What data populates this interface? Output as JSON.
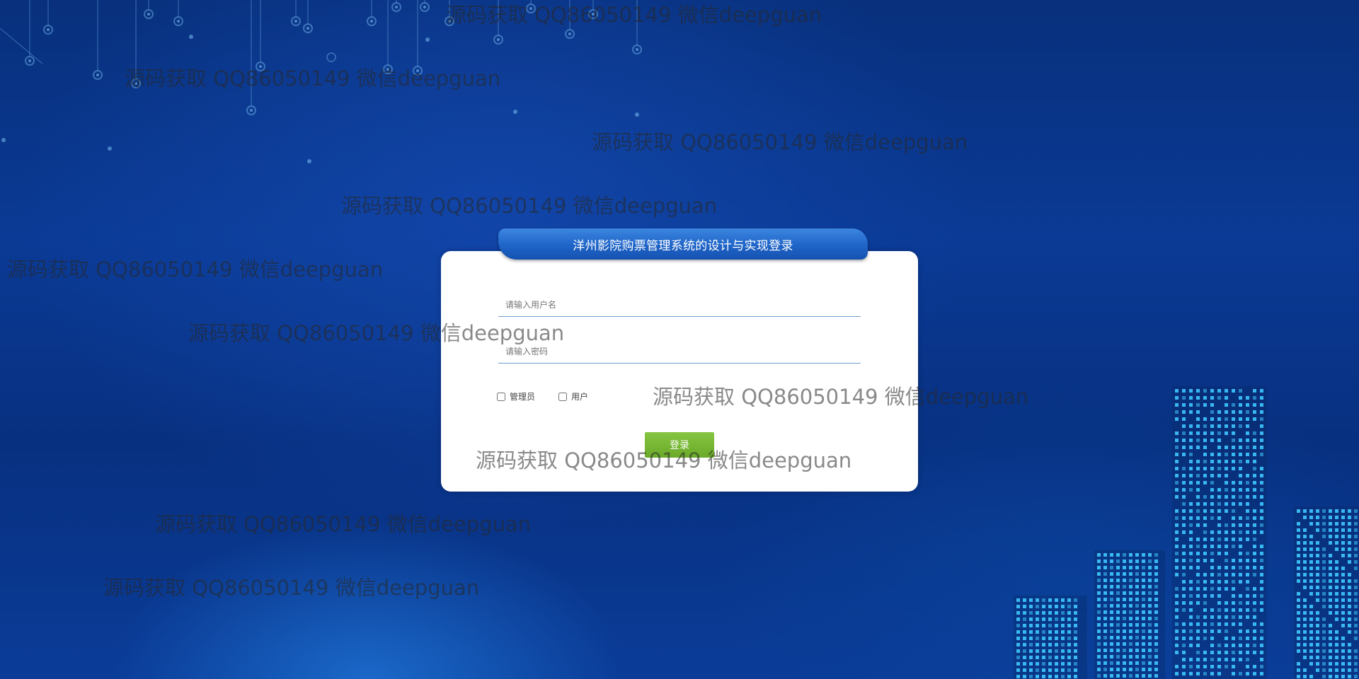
{
  "login": {
    "title": "洋州影院购票管理系统的设计与实现登录",
    "username_placeholder": "请输入用户名",
    "password_placeholder": "请输入密码",
    "roles": [
      {
        "label": "管理员",
        "checked": false
      },
      {
        "label": "用户",
        "checked": false
      }
    ],
    "submit_label": "登录"
  },
  "watermark": {
    "text": "源码获取 QQ86050149 微信deepguan"
  },
  "colors": {
    "background": "#0a3a95",
    "title_bar": "#1e64c8",
    "login_button": "#6aaa28",
    "building_lights": "#3fc6ff"
  },
  "decorations": {
    "top_left": "network-nodes-icon",
    "bottom_right": "city-skyline-icon"
  }
}
